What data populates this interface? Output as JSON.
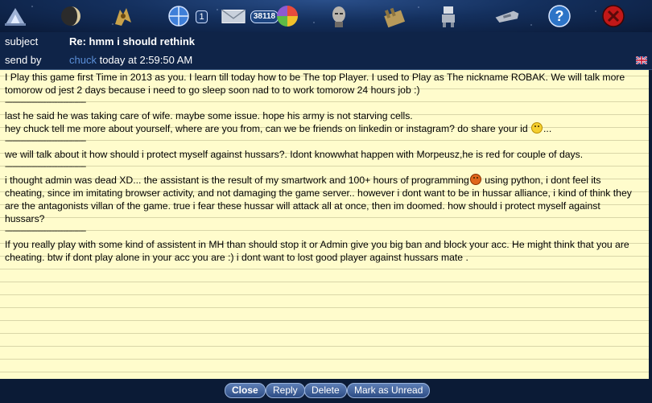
{
  "toolbar": {
    "icons": [
      "fleet-ships-icon",
      "planet-icon",
      "alien-craft-icon",
      "globe-crosshair-icon",
      "envelope-icon",
      "color-wheel-icon",
      "commander-head-icon",
      "factory-icon",
      "robot-icon",
      "battle-cruiser-icon",
      "help-icon",
      "close-icon"
    ],
    "planets_count": "1",
    "messages_count": "38118"
  },
  "header": {
    "subject_label": "subject",
    "subject": "Re: hmm i should rethink",
    "sender_label": "send by",
    "sender": "chuck",
    "sent_time": "today at 2:59:50 AM"
  },
  "message": {
    "p1": "I Play this game first Time in 2013 as you. I learn till today how to be The top Player. I used to Play as The nickname ROBAK. We will talk more tomorow od jest 2 days because i need to go sleep soon nad to to work tomorow 24 hours job :)",
    "separator": "-------------------------------------------",
    "p2a": "last he said he was taking care of wife. maybe some issue. hope his army is not starving cells.",
    "p2b": "hey chuck tell me more about yourself, where are you from, can we be friends on linkedin or instagram? do share your id",
    "p2b_tail": "...",
    "p3": "we will talk about it how should i protect myself against hussars?. Idont knowwhat happen with Morpeusz,he is red for couple of days.",
    "p4a": "i thought admin was dead XD... the assistant is the result of my smartwork and 100+ hours of programming",
    "p4b": " using python, i dont feel its cheating, since im imitating browser activity, and not damaging the game server.. however i dont want to be in hussar alliance, i kind of think they are the antagonists villan of the game. true i fear these hussar will attack all at once, then im doomed. how should i protect myself against hussars?",
    "p5": "If you really play with some kind of assistent in MH than should stop it or Admin give you big ban and block your acc. He might think that you are cheating. btw if dont play alone in your acc you are :) i dont want to lost good player against hussars mate ."
  },
  "buttons": {
    "close": "Close",
    "reply": "Reply",
    "delete": "Delete",
    "mark_unread": "Mark as Unread"
  },
  "colors": {
    "background": "#0b1b36",
    "paper": "#fffccc",
    "sender_link": "#5b8fd8",
    "button": "#3d5f99"
  }
}
